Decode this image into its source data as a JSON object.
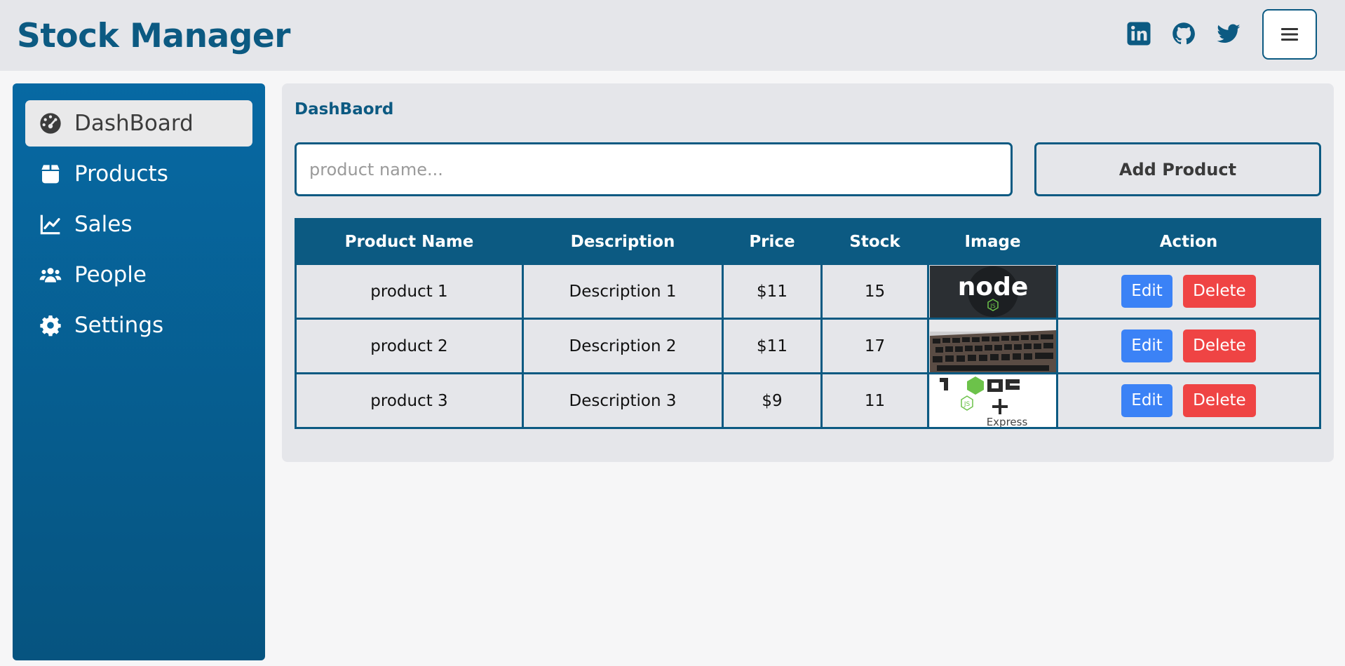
{
  "header": {
    "brand": "Stock Manager",
    "social": [
      "linkedin-icon",
      "github-icon",
      "twitter-icon"
    ],
    "menu_icon": "hamburger-menu-icon"
  },
  "sidebar": {
    "items": [
      {
        "label": "DashBoard",
        "icon": "dashboard-gauge-icon",
        "active": true
      },
      {
        "label": "Products",
        "icon": "box-icon",
        "active": false
      },
      {
        "label": "Sales",
        "icon": "line-chart-icon",
        "active": false
      },
      {
        "label": "People",
        "icon": "users-icon",
        "active": false
      },
      {
        "label": "Settings",
        "icon": "gear-icon",
        "active": false
      }
    ]
  },
  "main": {
    "breadcrumb": "DashBaord",
    "search_placeholder": "product name...",
    "search_value": "",
    "add_button": "Add Product"
  },
  "table": {
    "headers": [
      "Product Name",
      "Description",
      "Price",
      "Stock",
      "Image",
      "Action"
    ],
    "rows": [
      {
        "name": "product 1",
        "description": "Description 1",
        "price": "$11",
        "stock": "15",
        "image": "node-logo-dark",
        "image_text": "node"
      },
      {
        "name": "product 2",
        "description": "Description 2",
        "price": "$11",
        "stock": "17",
        "image": "laptop-keyboard-photo",
        "image_text": ""
      },
      {
        "name": "product 3",
        "description": "Description 3",
        "price": "$9",
        "stock": "11",
        "image": "node-express-logo",
        "image_text": "Express"
      }
    ],
    "edit_label": "Edit",
    "delete_label": "Delete"
  },
  "colors": {
    "primary": "#0c5a82",
    "sidebar_top": "#0769a3",
    "panel_bg": "#e5e6ea",
    "edit": "#3b82f6",
    "delete": "#ef4444"
  }
}
